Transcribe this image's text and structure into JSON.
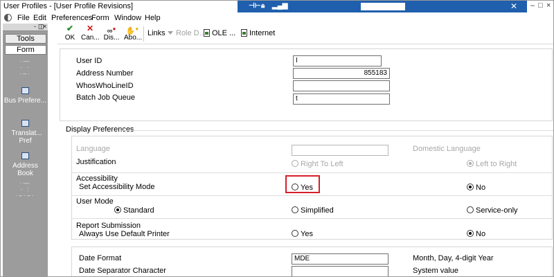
{
  "window": {
    "title": "User Profiles - [User Profile Revisions]",
    "minimize": "–",
    "maximize": "□",
    "close": "×",
    "center_close": "✕"
  },
  "menu": [
    "File",
    "Edit",
    "Preferences",
    "Form",
    "Window",
    "Help"
  ],
  "left_panel": {
    "controls": [
      "-",
      "◫",
      "×"
    ],
    "tabs": [
      {
        "label": "Tools",
        "active": false
      },
      {
        "label": "Form",
        "active": true
      }
    ],
    "items": [
      {
        "label": "Bus Prefere..."
      },
      {
        "label": "Translat... Pref"
      },
      {
        "label": "Address Book"
      }
    ]
  },
  "toolbar": {
    "buttons": [
      {
        "label": "OK",
        "icon": "check-icon"
      },
      {
        "label": "Can...",
        "icon": "cancel-x-icon"
      },
      {
        "label": "Dis...",
        "icon": "display-icon"
      },
      {
        "label": "Abo...",
        "icon": "about-icon"
      }
    ],
    "links_label": "Links",
    "role_label": "Role D...",
    "ole_label": "OLE ...",
    "internet_label": "Internet"
  },
  "header_fields": [
    {
      "label": "User ID",
      "value": "I"
    },
    {
      "label": "Address Number",
      "value": "855183"
    },
    {
      "label": "WhosWhoLineID",
      "value": ""
    },
    {
      "label": "Batch Job Queue",
      "value": "t"
    }
  ],
  "display_preferences": {
    "title": "Display Preferences",
    "language_label": "Language",
    "language_value": "",
    "domestic_language_label": "Domestic Language",
    "justification": {
      "label": "Justification",
      "options": [
        {
          "label": "Right To Left",
          "checked": false
        },
        {
          "label": "Left to Right",
          "checked": true
        }
      ]
    },
    "accessibility": {
      "group_label": "Accessibility",
      "label": "Set Accessibility Mode",
      "options": [
        {
          "label": "Yes",
          "checked": false
        },
        {
          "label": "No",
          "checked": true
        }
      ]
    },
    "user_mode": {
      "label": "User Mode",
      "options": [
        {
          "label": "Standard",
          "checked": true
        },
        {
          "label": "Simplified",
          "checked": false
        },
        {
          "label": "Service-only",
          "checked": false
        }
      ]
    },
    "report_submission": {
      "group_label": "Report Submission",
      "label": "Always Use Default Printer",
      "options": [
        {
          "label": "Yes",
          "checked": false
        },
        {
          "label": "No",
          "checked": true
        }
      ]
    }
  },
  "date": {
    "format_label": "Date Format",
    "format_value": "MDE",
    "format_desc": "Month, Day, 4-digit Year",
    "separator_label": "Date Separator Character",
    "separator_value": "",
    "separator_desc": "System value"
  },
  "colors": {
    "title_bar_blue": "#1f5fae",
    "left_panel_gray": "#9c9c9c",
    "highlight_red": "#d6202b"
  }
}
